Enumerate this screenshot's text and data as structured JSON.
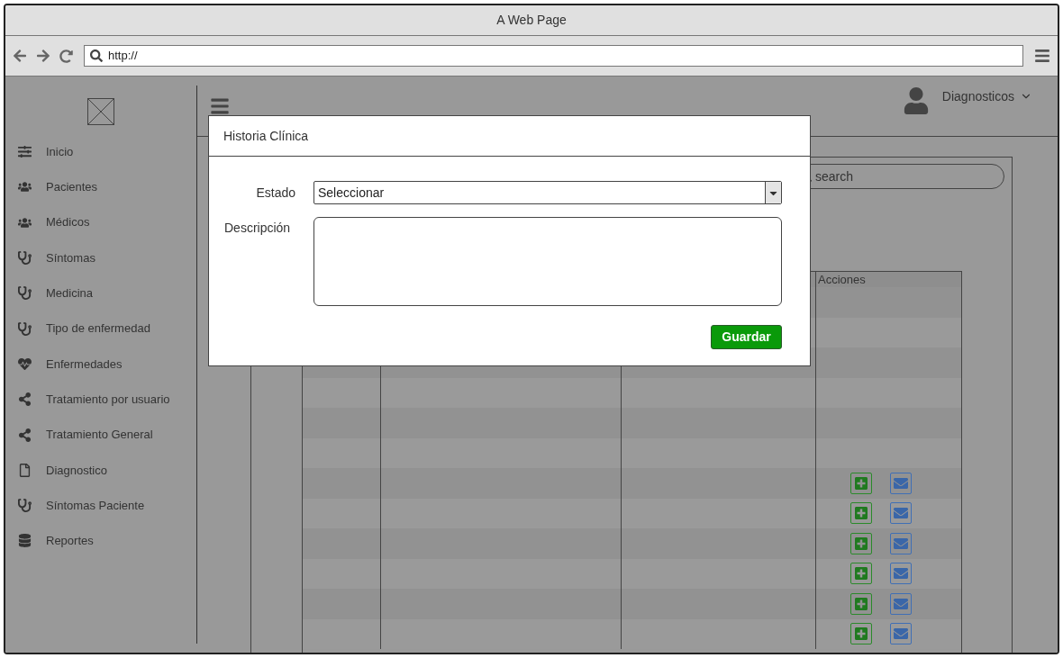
{
  "window": {
    "title": "A Web Page"
  },
  "address_bar": {
    "value": "http://"
  },
  "sidebar": {
    "items": [
      {
        "label": "Inicio",
        "kind": "sliders"
      },
      {
        "label": "Pacientes",
        "kind": "group"
      },
      {
        "label": "Médicos",
        "kind": "group"
      },
      {
        "label": "Síntomas",
        "kind": "stethoscope"
      },
      {
        "label": "Medicina",
        "kind": "stethoscope"
      },
      {
        "label": "Tipo de enfermedad",
        "kind": "stethoscope"
      },
      {
        "label": "Enfermedades",
        "kind": "heartbeat"
      },
      {
        "label": "Tratamiento por usuario",
        "kind": "share"
      },
      {
        "label": "Tratamiento General",
        "kind": "share"
      },
      {
        "label": "Diagnostico",
        "kind": "file"
      },
      {
        "label": "Síntomas Paciente",
        "kind": "stethoscope"
      },
      {
        "label": "Reportes",
        "kind": "database"
      }
    ]
  },
  "header": {
    "user_menu": "Diagnosticos"
  },
  "search": {
    "placeholder": "search"
  },
  "table": {
    "columns": [
      "Acciones"
    ],
    "rows": [
      {
        "actions": false
      },
      {
        "actions": false
      },
      {
        "actions": false
      },
      {
        "actions": false
      },
      {
        "actions": false
      },
      {
        "actions": false
      },
      {
        "actions": true
      },
      {
        "actions": true
      },
      {
        "actions": true
      },
      {
        "actions": true
      },
      {
        "actions": true
      },
      {
        "actions": true
      }
    ]
  },
  "modal": {
    "title": "Historia Clínica",
    "fields": [
      {
        "kind": "select",
        "label": "Estado",
        "value": "Seleccionar"
      },
      {
        "kind": "textarea",
        "label": "Descripción"
      }
    ],
    "button": "Guardar"
  }
}
